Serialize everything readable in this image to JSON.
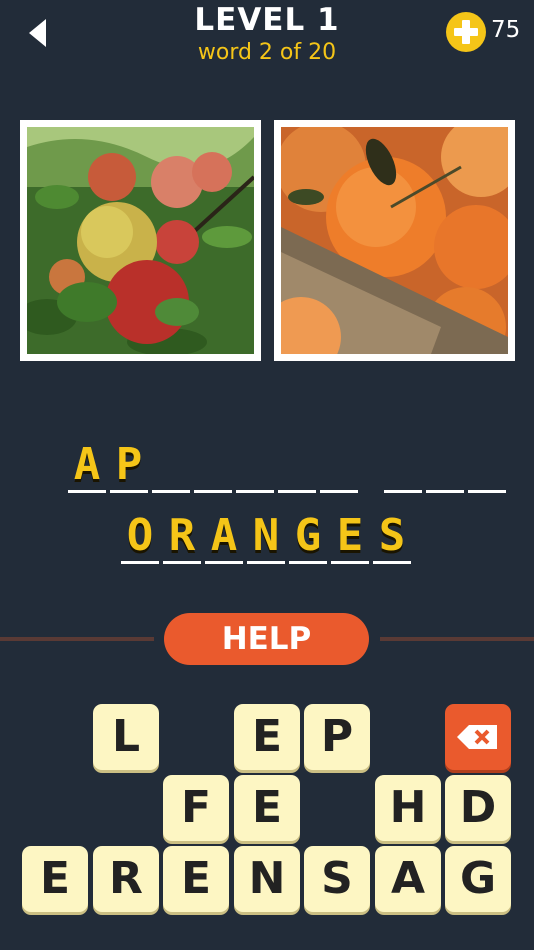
{
  "header": {
    "back_icon": "back-arrow-icon",
    "level_title": "LEVEL 1",
    "word_progress": "word 2 of 20",
    "coin_icon": "plus-coin-icon",
    "coins": "75"
  },
  "photos": [
    {
      "subject": "apples on a tree"
    },
    {
      "subject": "oranges in a crate"
    }
  ],
  "answer": {
    "line1": {
      "word1": [
        "A",
        "P",
        "",
        "",
        "",
        "",
        ""
      ],
      "word2": [
        "",
        "",
        ""
      ]
    },
    "line2": {
      "word1": [
        "O",
        "R",
        "A",
        "N",
        "G",
        "E",
        "S"
      ]
    }
  },
  "help": {
    "label": "HELP"
  },
  "keyboard": {
    "row1": [
      "L",
      "E",
      "P"
    ],
    "row2": [
      "F",
      "E",
      "H",
      "D"
    ],
    "row3": [
      "E",
      "R",
      "E",
      "N",
      "S",
      "A",
      "G"
    ],
    "delete_icon": "backspace-icon"
  },
  "colors": {
    "background": "#222c39",
    "accent": "#f5c518",
    "help": "#ea5a2d",
    "key": "#fdf6c3"
  }
}
